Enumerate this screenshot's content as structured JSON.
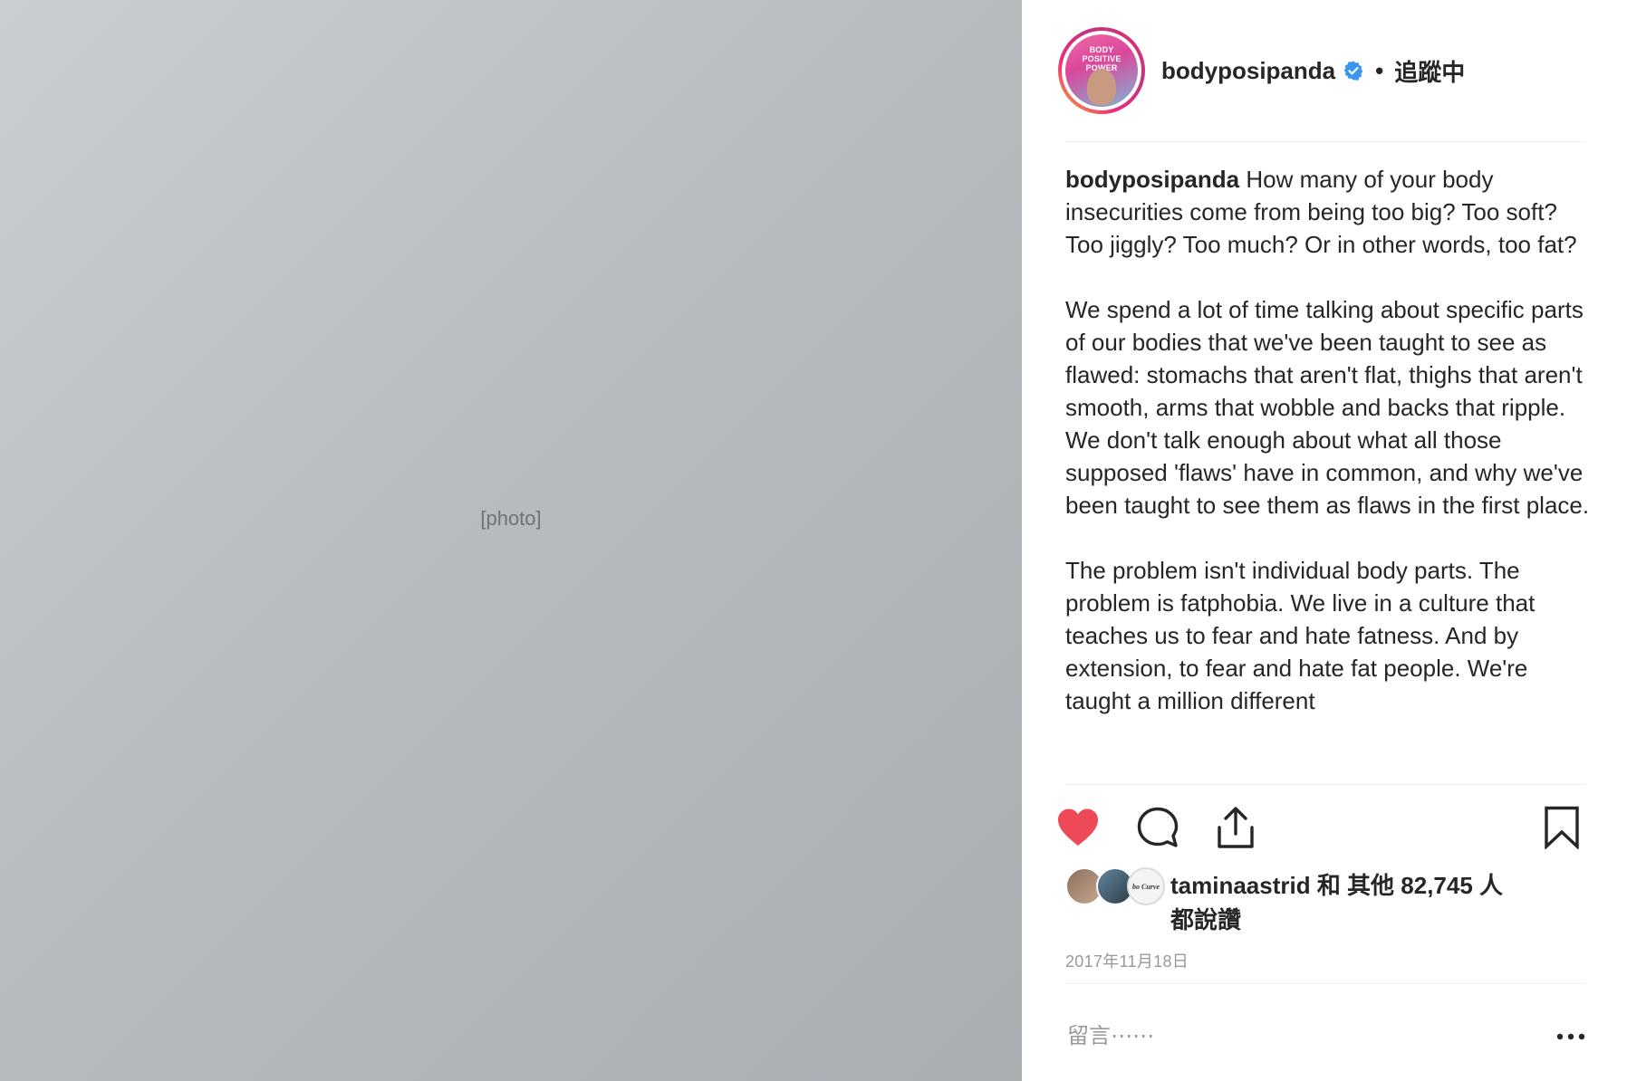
{
  "post": {
    "photo": {
      "icon": "photo-placeholder"
    },
    "header": {
      "avatar_text": "BODY\nPOSITIVE\nPOWER",
      "username": "bodyposipanda",
      "verified": true,
      "separator": "•",
      "follow_status": "追蹤中"
    },
    "caption": {
      "username": "bodyposipanda",
      "paragraphs": [
        " How many of your body insecurities come from being too big? Too soft? Too jiggly? Too much? Or in other words, too fat?",
        "We spend a lot of time talking about specific parts of our bodies that we've been taught to see as flawed: stomachs that aren't flat, thighs that aren't smooth, arms that wobble and backs that ripple. We don't talk enough about what all those supposed 'flaws' have in common, and why we've been taught to see them as flaws in the first place.",
        "The problem isn't individual body parts. The problem is fatphobia. We live in a culture that teaches us to fear and hate fatness. And by extension, to fear and hate fat people. We're taught a million different"
      ]
    },
    "actions": {
      "like_icon": "heart-icon",
      "liked": true,
      "comment_icon": "comment-icon",
      "share_icon": "share-icon",
      "save_icon": "bookmark-icon",
      "colors": {
        "liked": "#ed4956",
        "icon": "#262626"
      }
    },
    "likes": {
      "mini_avatar_3_text": "bo Curve",
      "line1": "taminaastrid 和 其他 82,745 人",
      "line2": "都說讚"
    },
    "date": "2017年11月18日",
    "comment": {
      "placeholder": "留言⋯⋯",
      "more_icon": "more-options-icon"
    }
  }
}
